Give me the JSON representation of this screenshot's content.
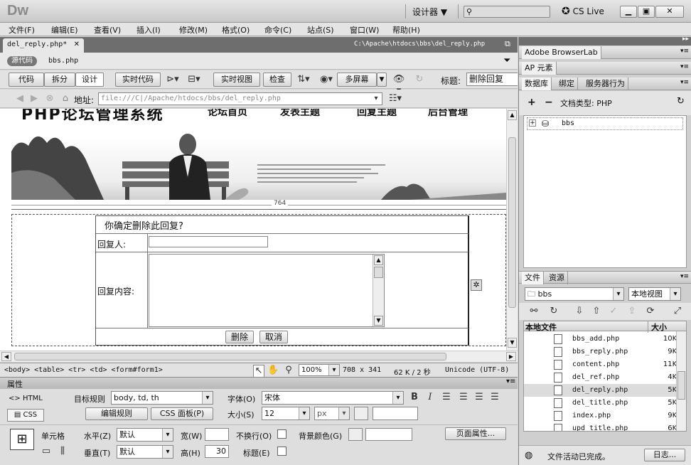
{
  "app": {
    "logo": "Dw",
    "workspace": "设计器",
    "search_placeholder": "",
    "cslive": "CS Live"
  },
  "menu": [
    "文件(F)",
    "编辑(E)",
    "查看(V)",
    "插入(I)",
    "修改(M)",
    "格式(O)",
    "命令(C)",
    "站点(S)",
    "窗口(W)",
    "帮助(H)"
  ],
  "doc": {
    "tab": "del_reply.php*",
    "path": "C:\\Apache\\htdocs\\bbs\\del_reply.php",
    "source_badge": "源代码",
    "related_file": "bbs.php"
  },
  "toolbar": {
    "code": "代码",
    "split": "拆分",
    "design": "设计",
    "live_code": "实时代码",
    "live_view": "实时视图",
    "inspect": "检查",
    "multiscreen": "多屏幕",
    "title_label": "标题:",
    "title_value": "删除回复"
  },
  "address": {
    "label": "地址:",
    "value": "file:///C|/Apache/htdocs/bbs/del_reply.php"
  },
  "page": {
    "nav": [
      "论坛首页",
      "发表主题",
      "回复主题",
      "后台管理"
    ],
    "header_text": "PHP论坛管理系统",
    "ruler_width": "764",
    "form_title": "你确定删除此回复?",
    "label_replier": "回复人:",
    "label_content": "回复内容:",
    "btn_delete": "删除",
    "btn_cancel": "取消"
  },
  "status": {
    "tags": "<body> <table> <tr> <td> <form#form1>",
    "zoom": "100%",
    "size": "708 x 341",
    "filesize": "62 K / 2 秒",
    "encoding": "Unicode (UTF-8)"
  },
  "props": {
    "title": "属性",
    "html": "HTML",
    "css": "CSS",
    "target_rule_label": "目标规则",
    "target_rule": "body, td, th",
    "edit_rule": "编辑规则",
    "css_panel": "CSS 面板(P)",
    "font_label": "字体(O)",
    "font_value": "宋体",
    "size_label": "大小(S)",
    "size_value": "12",
    "size_unit": "px",
    "cell": "单元格",
    "horz_label": "水平(Z)",
    "horz_value": "默认",
    "width_label": "宽(W)",
    "nowrap_label": "不换行(O)",
    "bg_label": "背景颜色(G)",
    "page_props": "页面属性...",
    "vert_label": "垂直(T)",
    "vert_value": "默认",
    "height_label": "高(H)",
    "height_value": "30",
    "header_label": "标题(E)"
  },
  "right": {
    "browserlab": "Adobe BrowserLab",
    "ap": "AP 元素",
    "db_tabs": [
      "数据库",
      "绑定",
      "服务器行为"
    ],
    "doc_type": "文档类型: PHP",
    "db_item": "bbs",
    "file_tabs": [
      "文件",
      "资源"
    ],
    "site": "bbs",
    "view": "本地视图",
    "col_name": "本地文件",
    "col_size": "大小",
    "files": [
      {
        "name": "bbs_add.php",
        "size": "10KB"
      },
      {
        "name": "bbs_reply.php",
        "size": "9KB"
      },
      {
        "name": "content.php",
        "size": "11KB"
      },
      {
        "name": "del_ref.php",
        "size": "4KB"
      },
      {
        "name": "del_reply.php",
        "size": "5KB"
      },
      {
        "name": "del_title.php",
        "size": "5KB"
      },
      {
        "name": "index.php",
        "size": "9KB"
      },
      {
        "name": "upd_title.php",
        "size": "6KB"
      }
    ],
    "status": "文件活动已完成。",
    "log": "日志..."
  }
}
